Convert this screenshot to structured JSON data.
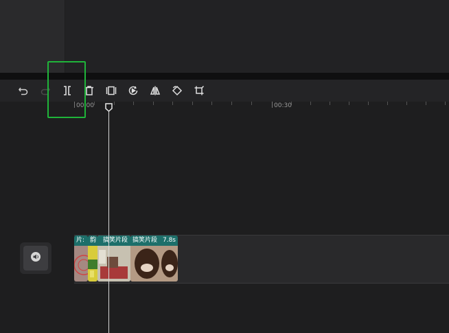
{
  "toolbar": {
    "tools": [
      {
        "name": "undo-icon",
        "enabled": true
      },
      {
        "name": "redo-icon",
        "enabled": false
      },
      {
        "name": "split-icon",
        "enabled": true
      },
      {
        "name": "delete-icon",
        "enabled": true
      },
      {
        "name": "freeze-frame-icon",
        "enabled": true
      },
      {
        "name": "reverse-icon",
        "enabled": true
      },
      {
        "name": "mirror-icon",
        "enabled": true
      },
      {
        "name": "rotate-icon",
        "enabled": true
      },
      {
        "name": "crop-icon",
        "enabled": true
      }
    ],
    "highlighted_tool": "split-icon"
  },
  "ruler": {
    "labels": [
      "00:00",
      "00:30"
    ]
  },
  "track": {
    "mute_icon": "speaker-icon",
    "clips": [
      {
        "label": "片:",
        "duration": ""
      },
      {
        "label": "韵",
        "duration": ""
      },
      {
        "label": "搞笑片段",
        "duration": "",
        "selected": true
      },
      {
        "label": "搞笑片段",
        "duration": "7.8s"
      }
    ]
  },
  "colors": {
    "clip_header": "#1d6f6a",
    "highlight": "#1fb53a",
    "playhead": "#d8d8d8"
  }
}
